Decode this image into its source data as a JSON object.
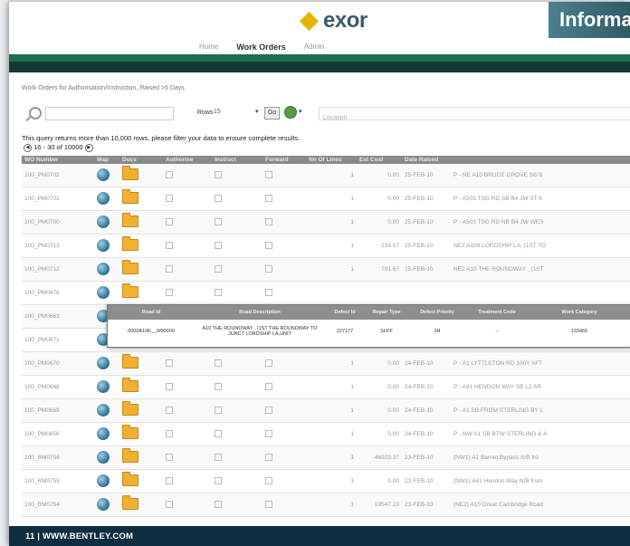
{
  "header": {
    "logo_text": "exor",
    "title": "Informat"
  },
  "tabs": [
    {
      "label": "Home"
    },
    {
      "label": "Work Orders"
    },
    {
      "label": "Admin"
    }
  ],
  "page_title": "Work Orders for Authorisation/Instruction, Raised >5 Days",
  "toolbar": {
    "rows_label": "Rows",
    "rows_value": "15",
    "go_label": "Go",
    "location_placeholder": "Location"
  },
  "notice": "This query returns more than 10,000 rows, please filter your data to ensure complete results.",
  "pager": "16 - 30 of 10000",
  "columns": [
    "WO Number",
    "Map",
    "Docs",
    "Authorise",
    "Instruct",
    "Forward",
    "No Of Lines",
    "Est Cost",
    "Date Raised"
  ],
  "rows": [
    {
      "wo": "100_PM0702",
      "lines": "1",
      "cost": "0.00",
      "date": "25-FEB-10",
      "desc": "P - NE A10 BRUCE GROVE SB B"
    },
    {
      "wo": "100_PM0701",
      "lines": "1",
      "cost": "0.00",
      "date": "25-FEB-10",
      "desc": "P - A503 TSG RD SB B4 JW ST A"
    },
    {
      "wo": "100_PM0700",
      "lines": "1",
      "cost": "0.00",
      "date": "25-FEB-10",
      "desc": "P - A503 TSG RD NB B4 JW WES"
    },
    {
      "wo": "100_PM0713",
      "lines": "1",
      "cost": "234.57",
      "date": "25-FEB-10",
      "desc": "NE2 A109 LORDSHIP LA, (1ST TO"
    },
    {
      "wo": "100_PM0712",
      "lines": "1",
      "cost": "701.67",
      "date": "25-FEB-10",
      "desc": "NE2 A10 THE ROUNDWAY , (1ST"
    },
    {
      "wo": "100_PM0478",
      "lines": "",
      "cost": "",
      "date": "",
      "desc": ""
    },
    {
      "wo": "100_PM0663",
      "lines": "",
      "cost": "",
      "date": "",
      "desc": ""
    },
    {
      "wo": "100_PM0671",
      "lines": "",
      "cost": "",
      "date": "",
      "desc": ""
    },
    {
      "wo": "100_PM0670",
      "lines": "1",
      "cost": "0.00",
      "date": "24-FEB-10",
      "desc": "P - A1 LYTTLETON RD 100Y AFT"
    },
    {
      "wo": "100_PM0668",
      "lines": "1",
      "cost": "0.00",
      "date": "24-FEB-10",
      "desc": "P - A41 HENDON WAY SB L2 AR"
    },
    {
      "wo": "100_PM0669",
      "lines": "1",
      "cost": "0.00",
      "date": "24-FEB-10",
      "desc": "P - A1 SB FROM STERLING BY L"
    },
    {
      "wo": "100_PM0658",
      "lines": "1",
      "cost": "0.00",
      "date": "24-FEB-10",
      "desc": "P - NW A1 SB BTW STERLING & A"
    },
    {
      "wo": "100_RM0756",
      "lines": "1",
      "cost": "46929.37",
      "date": "23-FEB-10",
      "desc": "(NW1) A1 Barnet Bypass S/B fro"
    },
    {
      "wo": "100_RM0755",
      "lines": "1",
      "cost": "0.00",
      "date": "23-FEB-10",
      "desc": "(NW1) A41 Hendon Way N/B from"
    },
    {
      "wo": "100_RM0754",
      "lines": "1",
      "cost": "19547.23",
      "date": "23-FEB-10",
      "desc": "(NE2) A10 Great Cambridge Road"
    }
  ],
  "popup": {
    "headers": [
      "Road Id",
      "Road Description",
      "Defect Id",
      "Repair Type",
      "Defect Priority",
      "Treatment Code",
      "Work Category"
    ],
    "values": [
      "0000A10E__0/00000",
      "A10 THE ROUNDWAY , (1ST THE ROUNDWAY TO JUNCT LORDSHIP LA,UNIT",
      "227177",
      "SLPF",
      "2H",
      "–",
      "133465"
    ]
  },
  "footer": "11 | WWW.BENTLEY.COM"
}
